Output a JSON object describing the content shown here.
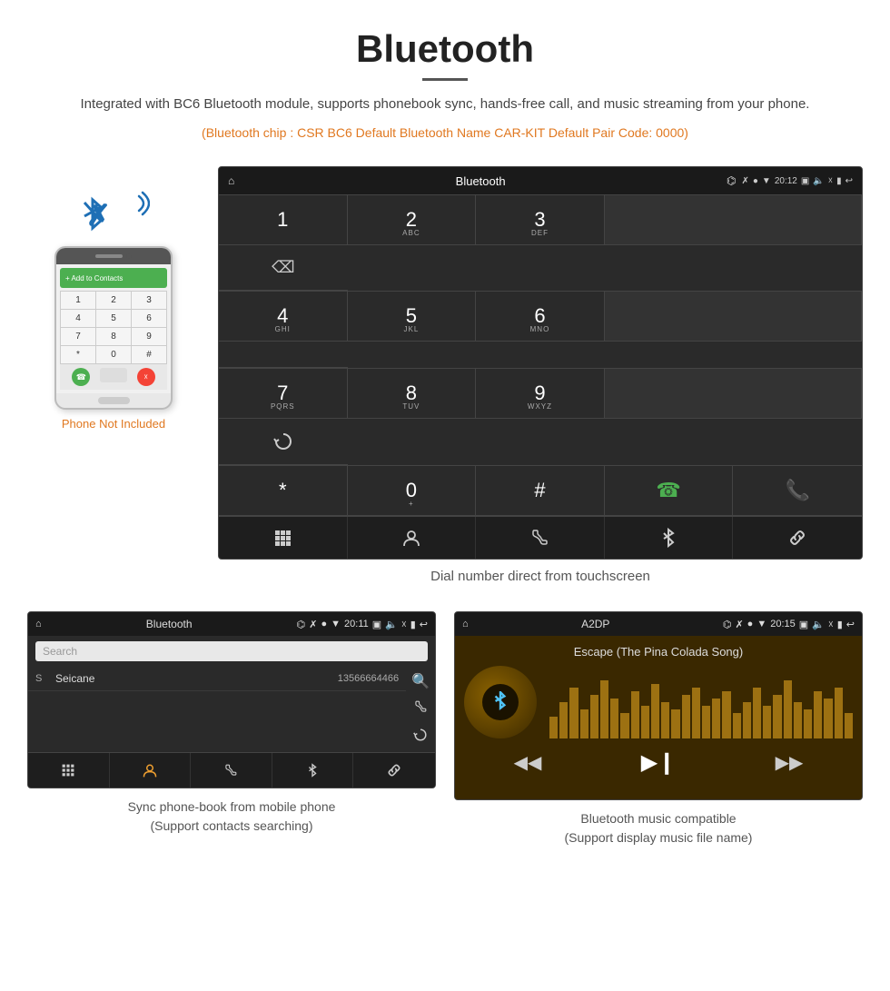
{
  "header": {
    "title": "Bluetooth",
    "description": "Integrated with BC6 Bluetooth module, supports phonebook sync, hands-free call, and music streaming from your phone.",
    "specs": "(Bluetooth chip : CSR BC6    Default Bluetooth Name CAR-KIT    Default Pair Code: 0000)"
  },
  "phone_label": "Phone Not Included",
  "dial_screen": {
    "title": "Bluetooth",
    "time": "20:12",
    "keys": [
      {
        "num": "1",
        "sub": ""
      },
      {
        "num": "2",
        "sub": "ABC"
      },
      {
        "num": "3",
        "sub": "DEF"
      },
      {
        "num": "4",
        "sub": "GHI"
      },
      {
        "num": "5",
        "sub": "JKL"
      },
      {
        "num": "6",
        "sub": "MNO"
      },
      {
        "num": "7",
        "sub": "PQRS"
      },
      {
        "num": "8",
        "sub": "TUV"
      },
      {
        "num": "9",
        "sub": "WXYZ"
      },
      {
        "num": "*",
        "sub": ""
      },
      {
        "num": "0",
        "sub": "+"
      },
      {
        "num": "#",
        "sub": ""
      }
    ]
  },
  "dial_caption": "Dial number direct from touchscreen",
  "phonebook_screen": {
    "title": "Bluetooth",
    "time": "20:11",
    "search_placeholder": "Search",
    "contacts": [
      {
        "letter": "S",
        "name": "Seicane",
        "number": "13566664466"
      }
    ]
  },
  "phonebook_caption_line1": "Sync phone-book from mobile phone",
  "phonebook_caption_line2": "(Support contacts searching)",
  "music_screen": {
    "title": "A2DP",
    "time": "20:15",
    "song_title": "Escape (The Pina Colada Song)",
    "visualizer_bars": [
      30,
      50,
      70,
      40,
      60,
      80,
      55,
      35,
      65,
      45,
      75,
      50,
      40,
      60,
      70,
      45,
      55,
      65,
      35,
      50,
      70,
      45,
      60,
      80,
      50,
      40,
      65,
      55,
      70,
      35
    ]
  },
  "music_caption_line1": "Bluetooth music compatible",
  "music_caption_line2": "(Support display music file name)"
}
